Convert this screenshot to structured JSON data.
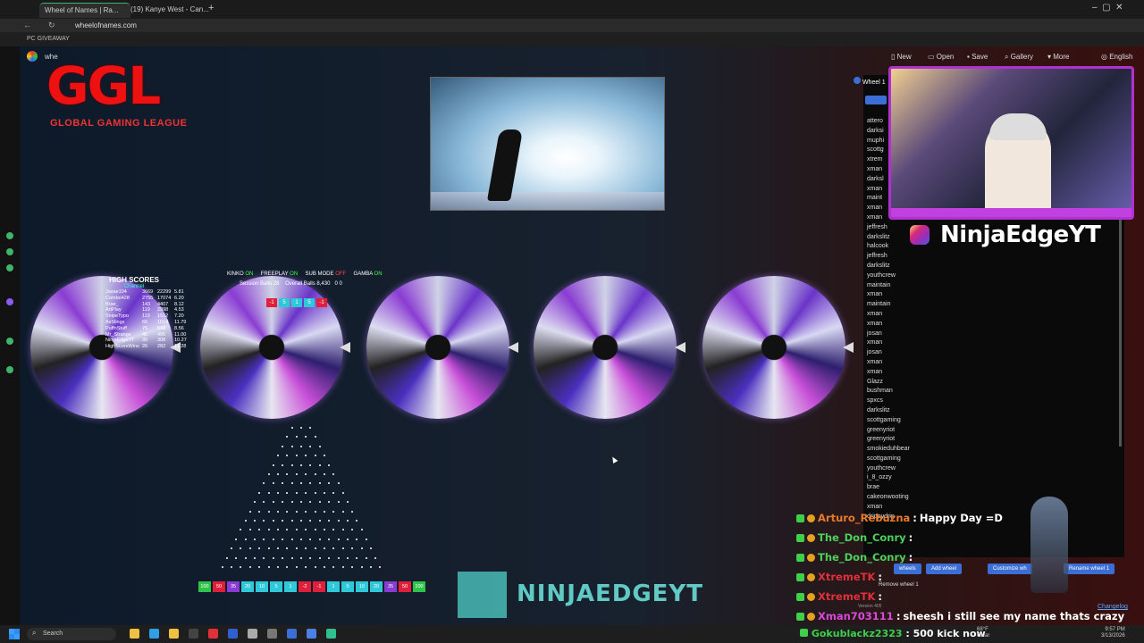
{
  "browser": {
    "tabs": [
      {
        "label": "Wheel of Names | Ra...",
        "active": true
      },
      {
        "label": "(19) Kanye West - Can...",
        "active": false
      }
    ],
    "url": "wheelofnames.com",
    "bookmark": "PC GIVEAWAY"
  },
  "app": {
    "title": "whe",
    "menu": [
      "New",
      "Open",
      "Save",
      "Gallery",
      "More",
      "English"
    ],
    "wheel_tab": "Wheel 1"
  },
  "logo": {
    "mark": "GGL",
    "subtitle": "GLOBAL GAMING LEAGUE"
  },
  "scoreboard": {
    "title": "HIGH SCORES",
    "subtitle": "Channel",
    "rows": [
      [
        "Jasae104",
        "3669",
        "22299",
        "5.81"
      ],
      [
        "Combo428",
        "2755",
        "17074",
        "6.20"
      ],
      [
        "Brae_",
        "143",
        "4407",
        "8.12"
      ],
      [
        "ArtPlay",
        "119",
        "2998",
        "4.53"
      ],
      [
        "SnipeTypo",
        "119",
        "1512",
        "7.20"
      ],
      [
        "AxSlings",
        "66",
        "1014",
        "11.79"
      ],
      [
        "PuffnStuff",
        "75",
        "648",
        "8.56"
      ],
      [
        "Mr_Strange",
        "45",
        "495",
        "11.00"
      ],
      [
        "NinjaEdgeYT",
        "30",
        "308",
        "10.27"
      ],
      [
        "HighScoreWins",
        "26",
        "282",
        "11.28"
      ]
    ]
  },
  "modes": {
    "items": [
      {
        "label": "KINKO",
        "state": "ON"
      },
      {
        "label": "FREEPLAY",
        "state": "ON"
      },
      {
        "label": "SUB MODE",
        "state": "OFF"
      },
      {
        "label": "GAMBA",
        "state": "ON"
      }
    ],
    "session_label": "Session Balls",
    "session_value": "28",
    "overall_label": "Overall Balls",
    "overall_value": "8,430",
    "extra": "0 0"
  },
  "top_pills": [
    "-1",
    "5",
    "1",
    "5",
    "-1"
  ],
  "bins": [
    "100",
    "50",
    "35",
    "20",
    "10",
    "5",
    "1",
    "-2",
    "-1",
    "1",
    "5",
    "10",
    "20",
    "35",
    "50",
    "100"
  ],
  "watermark": "NINJAEDGEYT",
  "names": [
    "attero",
    "darksi",
    "muphi",
    "scottg",
    "xtrem",
    "xman",
    "darksl",
    "xman",
    "maint",
    "xman",
    "xman",
    "jeffresh",
    "darkslitz",
    "halcook",
    "jeffresh",
    "darkslitz",
    "youthcrew",
    "maintain",
    "xman",
    "maintain",
    "xman",
    "xman",
    "josan",
    "xman",
    "josan",
    "xman",
    "xman",
    "Glazz",
    "bushman",
    "spxcs",
    "darkslitz",
    "scottgaming",
    "greenyriot",
    "greenyriot",
    "smokieduhbear",
    "scottgaming",
    "youthcrew",
    "i_8_ozzy",
    "brae",
    "cakeonwooting",
    "xman",
    "drippydrip"
  ],
  "brand": {
    "name": "NinjaEdgeYT"
  },
  "chat": [
    {
      "user": "Arturo_Rebuzna",
      "color": "#e87a2a",
      "msg": "Happy Day =D"
    },
    {
      "user": "The_Don_Conry",
      "color": "#4ad15a",
      "msg": ""
    },
    {
      "user": "The_Don_Conry",
      "color": "#4ad15a",
      "msg": ""
    },
    {
      "user": "XtremeTK",
      "color": "#e0303a",
      "msg": ""
    },
    {
      "user": "XtremeTK",
      "color": "#e0303a",
      "msg": ""
    },
    {
      "user": "Xman703111",
      "color": "#d94ad9",
      "msg": "sheesh i still see my name thats crazy"
    }
  ],
  "wheel_buttons": [
    "wheels",
    "Add wheel",
    "Customize wh",
    "Rename wheel 1"
  ],
  "remove_wheel": "Remove wheel 1",
  "version": "Version 405",
  "changelog": "Changelog",
  "taskbar": {
    "search": "Search",
    "notification_user": "Gokublackz2323",
    "notification_msg": "500 kick now",
    "weather": "68°F",
    "weather_sub": "Clear",
    "time": "9:57 PM",
    "date": "3/13/2026"
  },
  "colors": {
    "accent_purple": "#b030d0",
    "logo_red": "#e11111",
    "teal": "#4fd0c8",
    "chat_green": "#3fcf4a"
  }
}
